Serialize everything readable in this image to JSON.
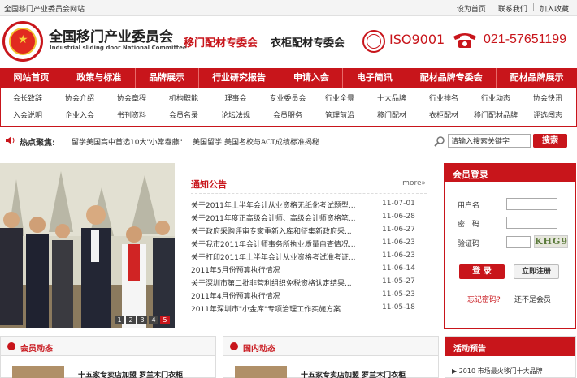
{
  "topbar": {
    "site_name": "全国移门产业委员会网站",
    "links": [
      "设为首页",
      "联系我们",
      "加入收藏"
    ]
  },
  "header": {
    "title": "全国移门产业委员会",
    "subtitle": "Industrial sliding door National Committee",
    "committee_1": "移门配材专委会",
    "committee_2": "衣柜配材专委会",
    "iso": "ISO9001",
    "phone": "021-57651199",
    "brand_color": "#c8151b"
  },
  "main_nav": [
    "网站首页",
    "政策与标准",
    "品牌展示",
    "行业研究报告",
    "申请入会",
    "电子简讯",
    "配材品牌专委会",
    "配材品牌展示"
  ],
  "sub_nav": {
    "row1": [
      "会长致辞",
      "协会介绍",
      "协会章程",
      "机构职能",
      "理事会",
      "专业委员会",
      "行业全景",
      "十大品牌",
      "行业排名",
      "行业动态",
      "协会快讯"
    ],
    "row2": [
      "入会说明",
      "企业入会",
      "书刊资料",
      "会员名录",
      "论坛法规",
      "会员服务",
      "管理前沿",
      "移门配材",
      "衣柜配材",
      "移门配材品牌",
      "评选闯志"
    ]
  },
  "hot": {
    "label": "热点聚焦:",
    "items": [
      "留学美国高中首选10大\"小常春藤\"",
      "美国留学:美国名校与ACT成绩标准揭秘"
    ]
  },
  "search": {
    "placeholder": "请输入搜索关键字",
    "button": "搜索"
  },
  "slideshow": {
    "pages": [
      "1",
      "2",
      "3",
      "4",
      "5"
    ],
    "active_page": "5"
  },
  "notice": {
    "title": "通知公告",
    "more": "more»",
    "items": [
      {
        "title": "关于2011年上半年会计从业资格无纸化考试题型...",
        "date": "11-07-01"
      },
      {
        "title": "关于2011年度正高级会计师、高级会计师资格笔...",
        "date": "11-06-28"
      },
      {
        "title": "关于政府采购评审专家重新入库和征集新政府采...",
        "date": "11-06-27"
      },
      {
        "title": "关于我市2011年会计师事务所执业质量自查情况...",
        "date": "11-06-23"
      },
      {
        "title": "关于打印2011年上半年会计从业资格考试准考证...",
        "date": "11-06-23"
      },
      {
        "title": "2011年5月份预算执行情况",
        "date": "11-06-14"
      },
      {
        "title": "关于深圳市第二批非营利组织免税资格认定结果...",
        "date": "11-05-27"
      },
      {
        "title": "2011年4月份预算执行情况",
        "date": "11-05-23"
      },
      {
        "title": "2011年深圳市\"小金库\"专项治理工作实施方案",
        "date": "11-05-18"
      }
    ]
  },
  "login": {
    "title": "会员登录",
    "username_label": "用户名",
    "password_label": "密　码",
    "captcha_label": "验证码",
    "captcha_text": "KHG9",
    "login_button": "登 录",
    "register_button": "立即注册",
    "forgot": "忘记密码?",
    "not_member": "还不是会员"
  },
  "panels": {
    "member_news": {
      "title": "会员动态",
      "headline": "十五家专卖店加盟 罗兰木门衣柜"
    },
    "domestic_news": {
      "title": "国内动态",
      "headline": "十五家专卖店加盟 罗兰木门衣柜"
    },
    "activity": {
      "title": "活动预告",
      "item": "2010 市场最火移门十大品牌"
    }
  }
}
